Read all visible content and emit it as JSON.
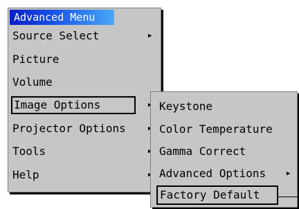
{
  "main_menu": {
    "title": "Advanced Menu",
    "items": [
      {
        "label": "Source Select",
        "has_submenu": true
      },
      {
        "label": "Picture",
        "has_submenu": false
      },
      {
        "label": "Volume",
        "has_submenu": false
      },
      {
        "label": "Image Options",
        "has_submenu": true,
        "selected": true
      },
      {
        "label": "Projector Options",
        "has_submenu": true
      },
      {
        "label": "Tools",
        "has_submenu": true
      },
      {
        "label": "Help",
        "has_submenu": true
      }
    ]
  },
  "sub_menu": {
    "items": [
      {
        "label": "Keystone",
        "has_submenu": false
      },
      {
        "label": "Color Temperature",
        "has_submenu": false
      },
      {
        "label": "Gamma Correct",
        "has_submenu": false
      },
      {
        "label": "Advanced Options",
        "has_submenu": true
      },
      {
        "label": "Factory Default",
        "has_submenu": false,
        "selected": true
      }
    ]
  },
  "icons": {
    "submenu_arrow": "triangle-right-icon"
  },
  "colors": {
    "menu_background": "#c6c6c6",
    "title_gradient_start": "#0a1ec8",
    "title_gradient_end": "#4aa8f8",
    "title_text": "#ffffff",
    "selection_border": "#000000"
  }
}
